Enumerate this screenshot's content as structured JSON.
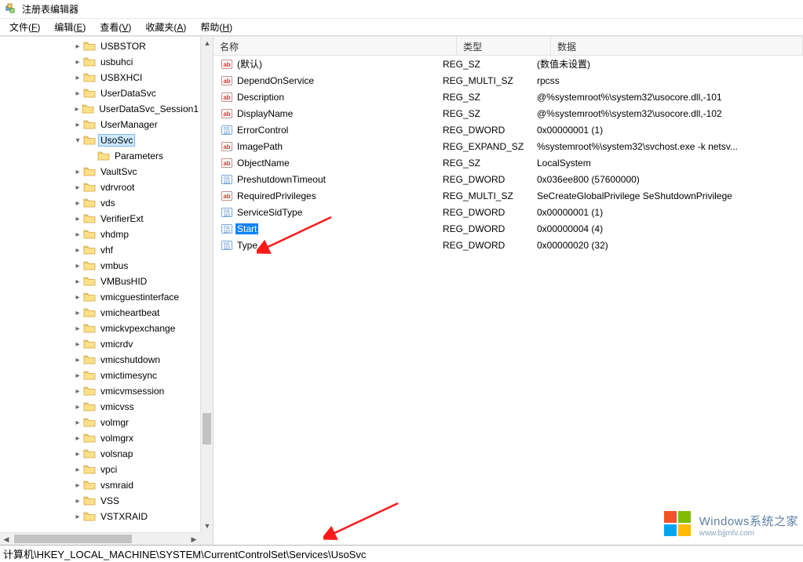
{
  "window_title": "注册表编辑器",
  "menu": [
    {
      "label": "文件",
      "hotkey": "F"
    },
    {
      "label": "编辑",
      "hotkey": "E"
    },
    {
      "label": "查看",
      "hotkey": "V"
    },
    {
      "label": "收藏夹",
      "hotkey": "A"
    },
    {
      "label": "帮助",
      "hotkey": "H"
    }
  ],
  "tree": [
    {
      "depth": 5,
      "exp": ">",
      "label": "USBSTOR"
    },
    {
      "depth": 5,
      "exp": ">",
      "label": "usbuhci"
    },
    {
      "depth": 5,
      "exp": ">",
      "label": "USBXHCI"
    },
    {
      "depth": 5,
      "exp": ">",
      "label": "UserDataSvc"
    },
    {
      "depth": 5,
      "exp": ">",
      "label": "UserDataSvc_Session1"
    },
    {
      "depth": 5,
      "exp": ">",
      "label": "UserManager"
    },
    {
      "depth": 5,
      "exp": "v",
      "label": "UsoSvc",
      "selected": true
    },
    {
      "depth": 6,
      "exp": "",
      "label": "Parameters"
    },
    {
      "depth": 5,
      "exp": ">",
      "label": "VaultSvc"
    },
    {
      "depth": 5,
      "exp": ">",
      "label": "vdrvroot"
    },
    {
      "depth": 5,
      "exp": ">",
      "label": "vds"
    },
    {
      "depth": 5,
      "exp": ">",
      "label": "VerifierExt"
    },
    {
      "depth": 5,
      "exp": ">",
      "label": "vhdmp"
    },
    {
      "depth": 5,
      "exp": ">",
      "label": "vhf"
    },
    {
      "depth": 5,
      "exp": ">",
      "label": "vmbus"
    },
    {
      "depth": 5,
      "exp": ">",
      "label": "VMBusHID"
    },
    {
      "depth": 5,
      "exp": ">",
      "label": "vmicguestinterface"
    },
    {
      "depth": 5,
      "exp": ">",
      "label": "vmicheartbeat"
    },
    {
      "depth": 5,
      "exp": ">",
      "label": "vmickvpexchange"
    },
    {
      "depth": 5,
      "exp": ">",
      "label": "vmicrdv"
    },
    {
      "depth": 5,
      "exp": ">",
      "label": "vmicshutdown"
    },
    {
      "depth": 5,
      "exp": ">",
      "label": "vmictimesync"
    },
    {
      "depth": 5,
      "exp": ">",
      "label": "vmicvmsession"
    },
    {
      "depth": 5,
      "exp": ">",
      "label": "vmicvss"
    },
    {
      "depth": 5,
      "exp": ">",
      "label": "volmgr"
    },
    {
      "depth": 5,
      "exp": ">",
      "label": "volmgrx"
    },
    {
      "depth": 5,
      "exp": ">",
      "label": "volsnap"
    },
    {
      "depth": 5,
      "exp": ">",
      "label": "vpci"
    },
    {
      "depth": 5,
      "exp": ">",
      "label": "vsmraid"
    },
    {
      "depth": 5,
      "exp": ">",
      "label": "VSS"
    },
    {
      "depth": 5,
      "exp": ">",
      "label": "VSTXRAID"
    }
  ],
  "list": {
    "headers": {
      "name": "名称",
      "type": "类型",
      "data": "数据"
    },
    "rows": [
      {
        "icon": "str",
        "name": "(默认)",
        "type": "REG_SZ",
        "data": "(数值未设置)"
      },
      {
        "icon": "str",
        "name": "DependOnService",
        "type": "REG_MULTI_SZ",
        "data": "rpcss"
      },
      {
        "icon": "str",
        "name": "Description",
        "type": "REG_SZ",
        "data": "@%systemroot%\\system32\\usocore.dll,-101"
      },
      {
        "icon": "str",
        "name": "DisplayName",
        "type": "REG_SZ",
        "data": "@%systemroot%\\system32\\usocore.dll,-102"
      },
      {
        "icon": "bin",
        "name": "ErrorControl",
        "type": "REG_DWORD",
        "data": "0x00000001 (1)"
      },
      {
        "icon": "str",
        "name": "ImagePath",
        "type": "REG_EXPAND_SZ",
        "data": "%systemroot%\\system32\\svchost.exe -k netsv..."
      },
      {
        "icon": "str",
        "name": "ObjectName",
        "type": "REG_SZ",
        "data": "LocalSystem"
      },
      {
        "icon": "bin",
        "name": "PreshutdownTimeout",
        "type": "REG_DWORD",
        "data": "0x036ee800 (57600000)"
      },
      {
        "icon": "str",
        "name": "RequiredPrivileges",
        "type": "REG_MULTI_SZ",
        "data": "SeCreateGlobalPrivilege SeShutdownPrivilege"
      },
      {
        "icon": "bin",
        "name": "ServiceSidType",
        "type": "REG_DWORD",
        "data": "0x00000001 (1)"
      },
      {
        "icon": "bin",
        "name": "Start",
        "type": "REG_DWORD",
        "data": "0x00000004 (4)",
        "selected": true
      },
      {
        "icon": "bin",
        "name": "Type",
        "type": "REG_DWORD",
        "data": "0x00000020 (32)"
      }
    ]
  },
  "status_path": "计算机\\HKEY_LOCAL_MACHINE\\SYSTEM\\CurrentControlSet\\Services\\UsoSvc",
  "watermark": {
    "line1": "Windows系统之家",
    "line2": "www.bjjmlv.com"
  }
}
